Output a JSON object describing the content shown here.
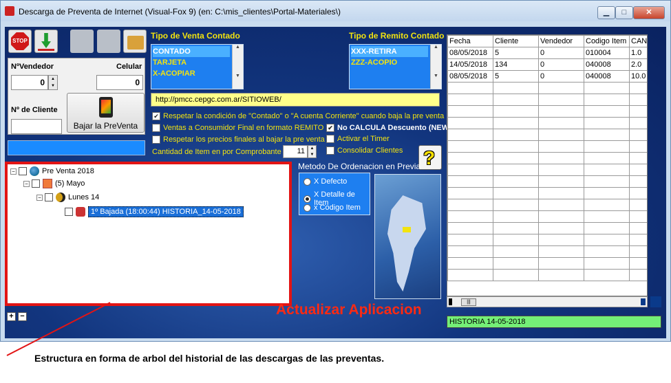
{
  "window": {
    "title": "Descarga de Preventa de Internet (Visual-Fox 9) (en: C:\\mis_clientes\\Portal-Materiales\\)",
    "minimize": "▁",
    "maximize": "□",
    "close": "✕"
  },
  "toolbar": {
    "stop_label": "STOP"
  },
  "vendedor": {
    "label": "NºVendedor",
    "value": "0"
  },
  "celular": {
    "label": "Celular",
    "value": "0"
  },
  "cliente": {
    "label": "Nº de Cliente",
    "value": ""
  },
  "bajar_button": {
    "label": "Bajar la PreVenta"
  },
  "tipo_venta": {
    "label": "Tipo de Venta Contado",
    "items": [
      "CONTADO",
      "TARJETA",
      "X-ACOPIAR"
    ],
    "selected": "CONTADO"
  },
  "tipo_remito": {
    "label": "Tipo de Remito Contado",
    "items": [
      "XXX-RETIRA",
      "ZZZ-ACOPIO"
    ],
    "selected": "XXX-RETIRA"
  },
  "url": "http://pmcc.cepgc.com.ar/SITIOWEB/",
  "options": {
    "respetar_condicion": {
      "label": "Respetar la condición de \"Contado\" o \"A cuenta Corriente\" cuando baja la pre venta",
      "checked": true
    },
    "ventas_consumidor": {
      "label": "Ventas a Consumidor Final  en formato REMITO",
      "checked": false
    },
    "no_calcula": {
      "label": "No CALCULA Descuento (NEW)",
      "checked": true
    },
    "respetar_precios": {
      "label": "Respetar los precios finales al bajar la pre venta",
      "checked": false
    },
    "activar_timer": {
      "label": "Activar el Timer",
      "checked": false
    },
    "consolidar": {
      "label": "Consolidar Clientes",
      "checked": false
    }
  },
  "cantidad": {
    "label": "Cantidad de Item en por Comprobante",
    "value": "11"
  },
  "help_icon": "?",
  "ordenacion": {
    "label": "Metodo De Ordenacion en Previa",
    "options": [
      "X Defecto",
      "X Detalle de Item",
      "x Codigo Item"
    ],
    "selected": 1
  },
  "tree": {
    "root": "Pre Venta 2018",
    "month": "(5) Mayo",
    "day": "Lunes 14",
    "download": "1º  Bajada (18:00:44) HISTORIA_14-05-2018"
  },
  "tree_buttons": {
    "expand": "+",
    "collapse": "−"
  },
  "actualizar_label": "Actualizar Aplicacion",
  "grid": {
    "columns": [
      "Fecha",
      "Cliente",
      "Vendedor",
      "Codigo Item",
      "CANTI"
    ],
    "rows": [
      [
        "08/05/2018",
        "5",
        "0",
        "010004",
        "1.0"
      ],
      [
        "14/05/2018",
        "134",
        "0",
        "040008",
        "2.0"
      ],
      [
        "08/05/2018",
        "5",
        "0",
        "040008",
        "10.0"
      ]
    ],
    "empty_rows": 17
  },
  "status_text": "HISTORIA  14-05-2018",
  "caption": "Estructura en forma de arbol del historial de las descargas de las preventas."
}
